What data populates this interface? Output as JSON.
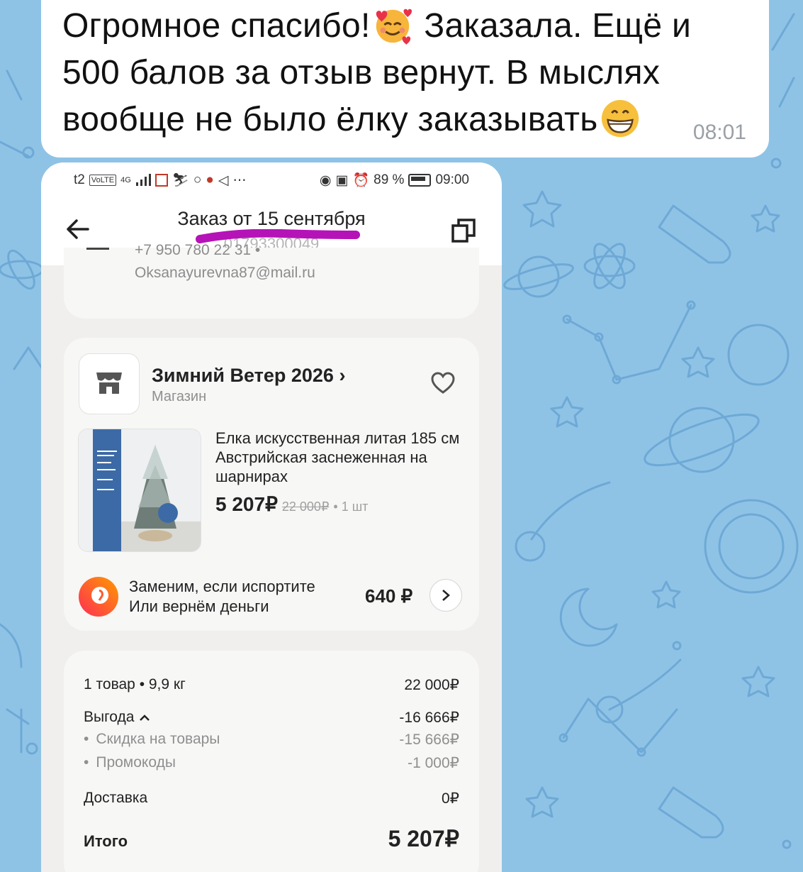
{
  "message": {
    "line1_a": "Огромное спасибо!",
    "line1_b": "Заказала. Ещё и",
    "line2": "500 балов за отзыв вернут.  В мыслях",
    "line3": "вообще не было ёлку заказывать",
    "time": "08:01",
    "emoji1": "smiling-face-with-hearts",
    "emoji2": "grinning-face"
  },
  "statusbar": {
    "carrier": "t2",
    "chip": "VoLTE",
    "network": "4G",
    "battery": "89 %",
    "time": "09:00"
  },
  "header": {
    "title": "Заказ от 15 сентября",
    "subtitle": "01793300049"
  },
  "contact": {
    "phone": "+7 950 780 22 31 •",
    "email": "Oksanayurevna87@mail.ru"
  },
  "shop": {
    "name": "Зимний Ветер 2026",
    "chevron": "›",
    "subtitle": "Магазин"
  },
  "product": {
    "name": "Елка искусственная литая 185 см Австрийская заснеженная на шарнирах",
    "price": "5 207₽",
    "old_price": "22 000₽",
    "qty": "• 1 шт"
  },
  "insurance": {
    "title": "Заменим, если испортите",
    "subtitle": "Или вернём деньги",
    "price": "640 ₽"
  },
  "summary": {
    "items_label": "1 товар • 9,9 кг",
    "items_value": "22 000₽",
    "benefit_label": "Выгода",
    "benefit_value": "-16 666₽",
    "discount_label": "Скидка на товары",
    "discount_value": "-15 666₽",
    "promo_label": "Промокоды",
    "promo_value": "-1 000₽",
    "delivery_label": "Доставка",
    "delivery_value": "0₽",
    "total_label": "Итого",
    "total_value": "5 207₽"
  },
  "colors": {
    "wallpaper": "#8fc3e6",
    "highlight": "#b513b8",
    "insurance_gradient": [
      "#ff2d55",
      "#ff9a00"
    ]
  }
}
